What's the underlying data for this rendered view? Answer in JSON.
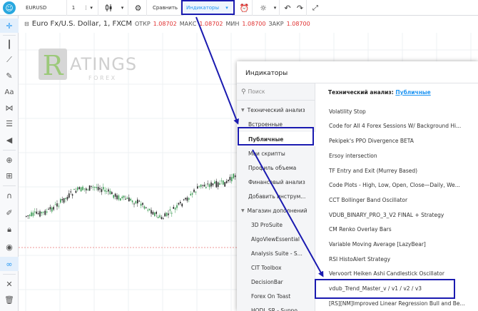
{
  "toolbar": {
    "symbol": "EURUSD",
    "interval": "1",
    "compare_label": "Сравнить",
    "indicators_label": "Индикаторы"
  },
  "chart": {
    "title": "Euro Fx/U.S. Dollar, 1, FXCM",
    "open_label": "ОТКР",
    "open": "1.08702",
    "high_label": "МАКС",
    "high": "1.08702",
    "low_label": "МИН",
    "low": "1.08700",
    "close_label": "ЗАКР",
    "close": "1.08700",
    "watermark_letter": "R",
    "watermark_word": "ATINGS",
    "watermark_sub": "F O R E X"
  },
  "dialog": {
    "title": "Индикаторы",
    "search_placeholder": "Поиск",
    "heading_prefix": "Технический анализ:",
    "heading_link": "Публичные",
    "side_items": [
      {
        "label": "Технический анализ"
      },
      {
        "label": "Встроенные"
      },
      {
        "label": "Публичные"
      },
      {
        "label": "Мои скрипты"
      },
      {
        "label": "Профиль объема"
      },
      {
        "label": "Финансовый анализ"
      },
      {
        "label": "Добавить инструм..."
      },
      {
        "label": "Магазин дополнений"
      },
      {
        "label": "3D ProSuite"
      },
      {
        "label": "AlgoViewEssential"
      },
      {
        "label": "Analysis Suite - S..."
      },
      {
        "label": "CIT Toolbox"
      },
      {
        "label": "DecisionBar"
      },
      {
        "label": "Forex On Toast"
      },
      {
        "label": "HODL SR - Suppo..."
      }
    ],
    "indicators": [
      "Volatility Stop",
      "Code for All 4 Forex Sessions W/ Background Hi...",
      "Pekipek's PPO Divergence BETA",
      "Ersoy intersection",
      "TF Entry and Exit (Murrey Based)",
      "Code Plots - High, Low, Open, Close—Daily, We...",
      "CCT Bollinger Band Oscillator",
      "VDUB_BINARY_PRO_3_V2 FINAL + Strategy",
      "CM Renko Overlay Bars",
      "Variable Moving Average [LazyBear]",
      "RSI HistoAlert Strategy",
      "Vervoort Heiken Ashi Candlestick Oscillator",
      "vdub_Trend_Master_v / v1 / v2 / v3",
      "[RS][NM]Improved Linear Regression Bull and Be..."
    ]
  },
  "colors": {
    "highlight": "#1a1ab0",
    "accent": "#2196f3",
    "candle_up": "#3a9a52",
    "candle_down": "#222222"
  }
}
